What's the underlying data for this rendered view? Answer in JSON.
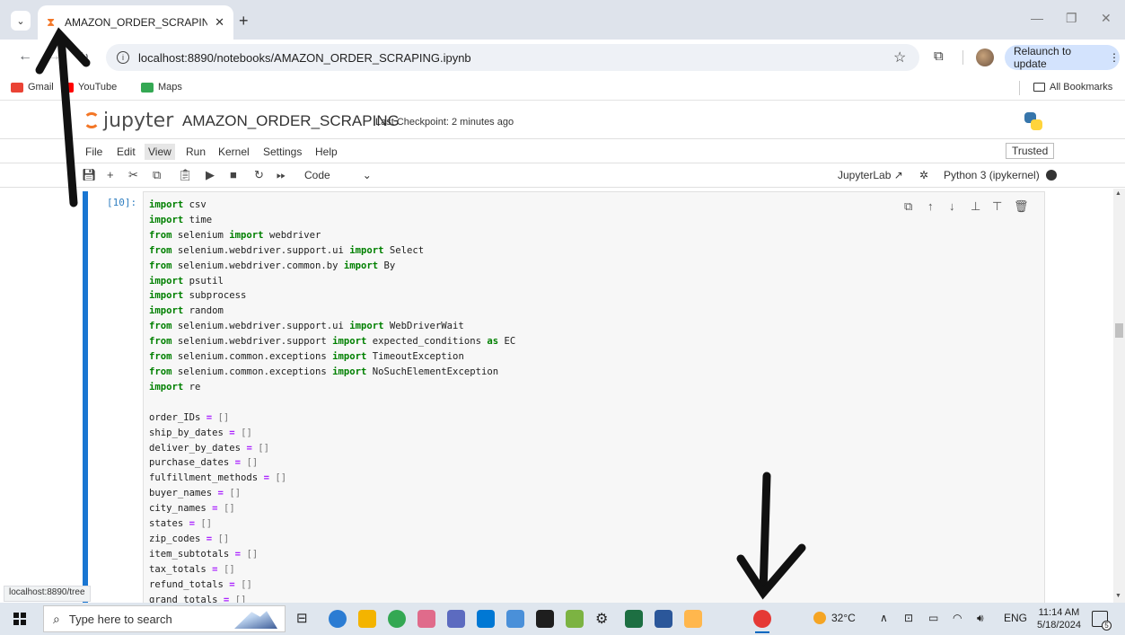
{
  "browser": {
    "tab_title": "AMAZON_ORDER_SCRAPING",
    "url": "localhost:8890/notebooks/AMAZON_ORDER_SCRAPING.ipynb",
    "relaunch_label": "Relaunch to update",
    "bookmarks": [
      {
        "label": "Gmail",
        "color": "#ea4335"
      },
      {
        "label": "YouTube",
        "color": "#ff0000"
      },
      {
        "label": "Maps",
        "color": "#34a853"
      }
    ],
    "all_bookmarks": "All Bookmarks",
    "status_link": "localhost:8890/tree"
  },
  "jupyter": {
    "logo_text": "jupyter",
    "notebook_name": "AMAZON_ORDER_SCRAPING",
    "checkpoint": "Last Checkpoint: 2 minutes ago",
    "menus": [
      "File",
      "Edit",
      "View",
      "Run",
      "Kernel",
      "Settings",
      "Help"
    ],
    "active_menu": "View",
    "trusted": "Trusted",
    "cell_type": "Code",
    "jupyterlab_link": "JupyterLab",
    "kernel_name": "Python 3 (ipykernel)",
    "cell_prompt": "[10]:"
  },
  "code_lines": [
    [
      [
        "kw",
        "import"
      ],
      [
        "t",
        " csv"
      ]
    ],
    [
      [
        "kw",
        "import"
      ],
      [
        "t",
        " time"
      ]
    ],
    [
      [
        "kw",
        "from"
      ],
      [
        "t",
        " selenium "
      ],
      [
        "kw",
        "import"
      ],
      [
        "t",
        " webdriver"
      ]
    ],
    [
      [
        "kw",
        "from"
      ],
      [
        "t",
        " selenium.webdriver.support.ui "
      ],
      [
        "kw",
        "import"
      ],
      [
        "t",
        " Select"
      ]
    ],
    [
      [
        "kw",
        "from"
      ],
      [
        "t",
        " selenium.webdriver.common.by "
      ],
      [
        "kw",
        "import"
      ],
      [
        "t",
        " By"
      ]
    ],
    [
      [
        "kw",
        "import"
      ],
      [
        "t",
        " psutil"
      ]
    ],
    [
      [
        "kw",
        "import"
      ],
      [
        "t",
        " subprocess"
      ]
    ],
    [
      [
        "kw",
        "import"
      ],
      [
        "t",
        " random"
      ]
    ],
    [
      [
        "kw",
        "from"
      ],
      [
        "t",
        " selenium.webdriver.support.ui "
      ],
      [
        "kw",
        "import"
      ],
      [
        "t",
        " WebDriverWait"
      ]
    ],
    [
      [
        "kw",
        "from"
      ],
      [
        "t",
        " selenium.webdriver.support "
      ],
      [
        "kw",
        "import"
      ],
      [
        "t",
        " expected_conditions "
      ],
      [
        "kw",
        "as"
      ],
      [
        "t",
        " EC"
      ]
    ],
    [
      [
        "kw",
        "from"
      ],
      [
        "t",
        " selenium.common.exceptions "
      ],
      [
        "kw",
        "import"
      ],
      [
        "t",
        " TimeoutException"
      ]
    ],
    [
      [
        "kw",
        "from"
      ],
      [
        "t",
        " selenium.common.exceptions "
      ],
      [
        "kw",
        "import"
      ],
      [
        "t",
        " NoSuchElementException"
      ]
    ],
    [
      [
        "kw",
        "import"
      ],
      [
        "t",
        " re"
      ]
    ],
    [
      [
        "t",
        ""
      ]
    ],
    [
      [
        "t",
        "order_IDs "
      ],
      [
        "op",
        "="
      ],
      [
        "pun",
        " []"
      ]
    ],
    [
      [
        "t",
        "ship_by_dates "
      ],
      [
        "op",
        "="
      ],
      [
        "pun",
        " []"
      ]
    ],
    [
      [
        "t",
        "deliver_by_dates "
      ],
      [
        "op",
        "="
      ],
      [
        "pun",
        " []"
      ]
    ],
    [
      [
        "t",
        "purchase_dates "
      ],
      [
        "op",
        "="
      ],
      [
        "pun",
        " []"
      ]
    ],
    [
      [
        "t",
        "fulfillment_methods "
      ],
      [
        "op",
        "="
      ],
      [
        "pun",
        " []"
      ]
    ],
    [
      [
        "t",
        "buyer_names "
      ],
      [
        "op",
        "="
      ],
      [
        "pun",
        " []"
      ]
    ],
    [
      [
        "t",
        "city_names "
      ],
      [
        "op",
        "="
      ],
      [
        "pun",
        " []"
      ]
    ],
    [
      [
        "t",
        "states "
      ],
      [
        "op",
        "="
      ],
      [
        "pun",
        " []"
      ]
    ],
    [
      [
        "t",
        "zip_codes "
      ],
      [
        "op",
        "="
      ],
      [
        "pun",
        " []"
      ]
    ],
    [
      [
        "t",
        "item_subtotals "
      ],
      [
        "op",
        "="
      ],
      [
        "pun",
        " []"
      ]
    ],
    [
      [
        "t",
        "tax_totals "
      ],
      [
        "op",
        "="
      ],
      [
        "pun",
        " []"
      ]
    ],
    [
      [
        "t",
        "refund_totals "
      ],
      [
        "op",
        "="
      ],
      [
        "pun",
        " []"
      ]
    ],
    [
      [
        "t",
        "grand_totals "
      ],
      [
        "op",
        "="
      ],
      [
        "pun",
        " []"
      ]
    ]
  ],
  "taskbar": {
    "search_placeholder": "Type here to search",
    "weather": "32°C",
    "language": "ENG",
    "time": "11:14 AM",
    "date": "5/18/2024",
    "notification_count": "5"
  }
}
